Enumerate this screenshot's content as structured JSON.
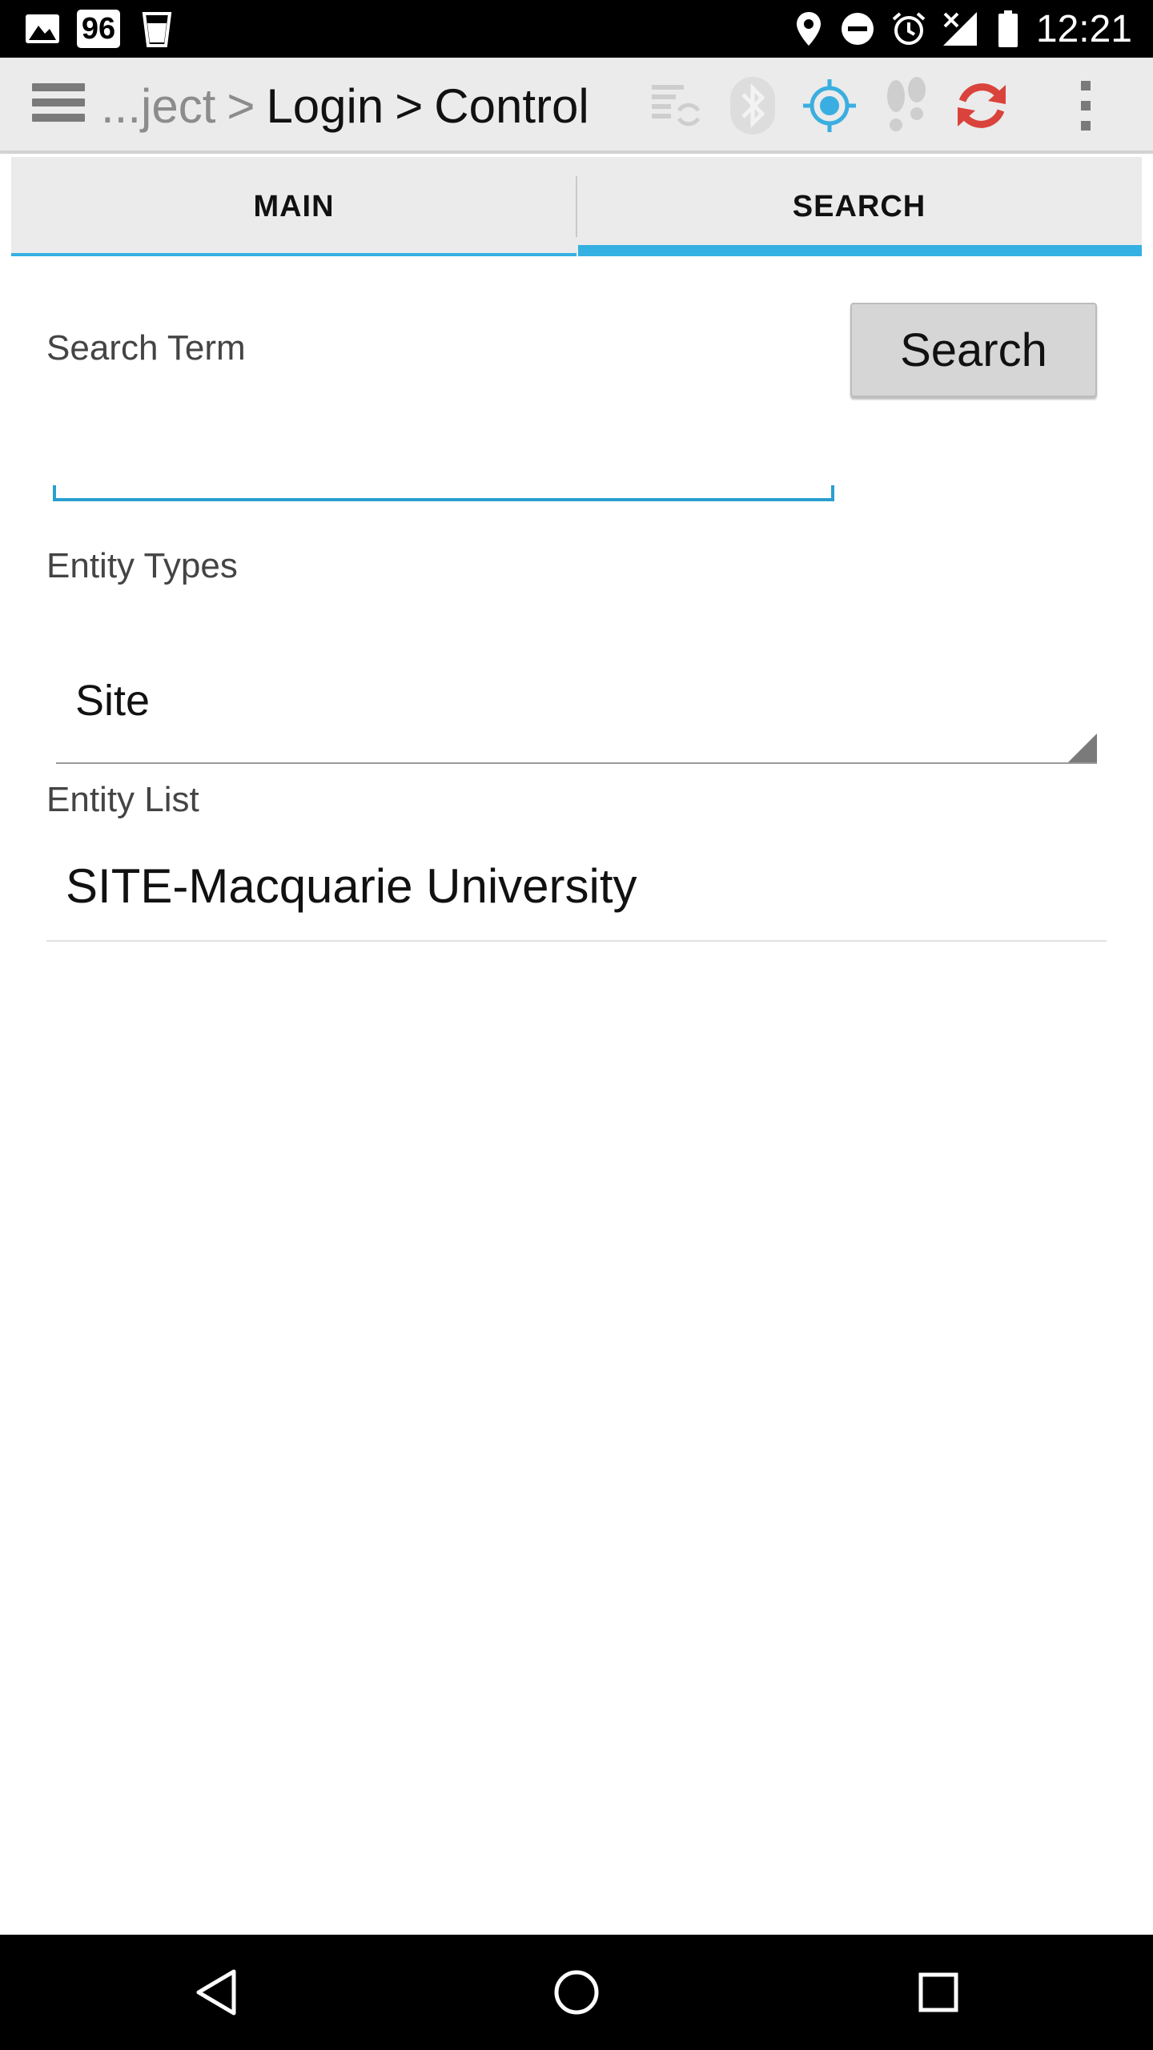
{
  "status_bar": {
    "battery_badge": "96",
    "time": "12:21",
    "icons": [
      "image-icon",
      "cup-icon",
      "location-pin-icon",
      "do-not-disturb-icon",
      "alarm-icon",
      "no-signal-icon",
      "battery-icon"
    ]
  },
  "action_bar": {
    "breadcrumb": {
      "truncated": "...ject",
      "separator": ">",
      "login": "Login",
      "control": "Control"
    },
    "icons": [
      "menu-icon",
      "sync-list-icon",
      "bluetooth-icon",
      "gps-icon",
      "footsteps-icon",
      "refresh-icon",
      "overflow-menu-icon"
    ]
  },
  "tabs": [
    {
      "label": "MAIN",
      "selected": false
    },
    {
      "label": "SEARCH",
      "selected": true
    }
  ],
  "search": {
    "term_label": "Search Term",
    "button_label": "Search",
    "input_value": "",
    "input_placeholder": ""
  },
  "entity_types": {
    "label": "Entity Types",
    "selected": "Site"
  },
  "entity_list": {
    "label": "Entity List",
    "items": [
      "SITE-Macquarie University"
    ]
  },
  "nav_bar": {
    "icons": [
      "back-icon",
      "home-icon",
      "recents-icon"
    ]
  },
  "colors": {
    "accent": "#35b0e2",
    "gps_icon": "#3aaee0",
    "refresh_icon": "#d9433b",
    "action_bar_bg": "#ebebeb"
  }
}
